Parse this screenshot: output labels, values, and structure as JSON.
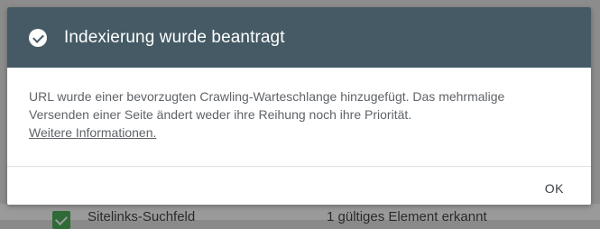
{
  "background": {
    "row_label": "Sitelinks-Suchfeld",
    "row_value": "1 gültiges Element erkannt"
  },
  "dialog": {
    "title": "Indexierung wurde beantragt",
    "message_line1": "URL wurde einer bevorzugten Crawling-Warteschlange hinzugefügt. Das mehrmalige",
    "message_line2": "Versenden einer Seite ändert weder ihre Reihung noch ihre Priorität.",
    "more_info_link": "Weitere Informationen.",
    "ok_label": "OK",
    "header_color": "#455a64",
    "icon": "check-circle-icon"
  }
}
